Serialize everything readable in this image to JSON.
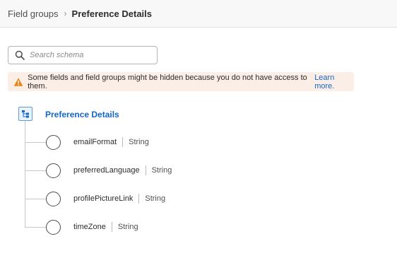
{
  "breadcrumb": {
    "parent": "Field groups",
    "separator": "›",
    "current": "Preference Details"
  },
  "search": {
    "placeholder": "Search schema",
    "icon": "search-icon"
  },
  "alert": {
    "icon": "warning-icon",
    "icon_color": "#e68619",
    "message": "Some fields and field groups might be hidden because you do not have access to them.",
    "link": "Learn more."
  },
  "tree": {
    "root_icon": "schema-tree-icon",
    "root_label": "Preference Details",
    "fields": [
      {
        "name": "emailFormat",
        "type": "String"
      },
      {
        "name": "preferredLanguage",
        "type": "String"
      },
      {
        "name": "profilePictureLink",
        "type": "String"
      },
      {
        "name": "timeZone",
        "type": "String"
      }
    ]
  },
  "colors": {
    "link": "#1466c8",
    "alert_bg": "#fbeee6"
  }
}
